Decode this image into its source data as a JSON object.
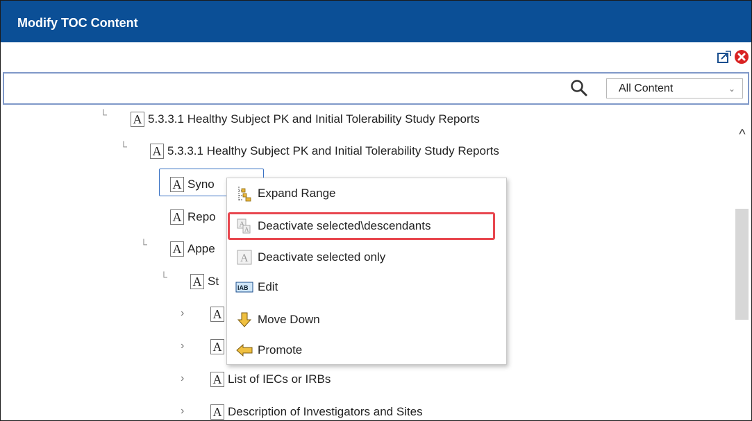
{
  "window": {
    "title": "Modify TOC Content"
  },
  "toolbar": {
    "icons": [
      "export-icon",
      "close-icon"
    ],
    "accent": "#0b4f96",
    "close_color": "#d92323"
  },
  "search": {
    "value": "",
    "placeholder": ""
  },
  "filter": {
    "selected": "All Content"
  },
  "tree": {
    "nodes": [
      {
        "label": "5.3.3.1 Healthy Subject PK and Initial Tolerability Study Reports",
        "marker": "A"
      },
      {
        "label": "5.3.3.1 Healthy Subject PK and Initial Tolerability Study Reports",
        "marker": "A"
      },
      {
        "label": "Syno",
        "marker": "A"
      },
      {
        "label": "Repo",
        "marker": "A"
      },
      {
        "label": "Appe",
        "marker": "A"
      },
      {
        "label": "St",
        "marker": "A"
      },
      {
        "label": "A",
        "marker": "A"
      },
      {
        "label": "A",
        "marker": "A"
      },
      {
        "label": "List of IECs or IRBs",
        "marker": "A"
      },
      {
        "label": "Description of Investigators and Sites",
        "marker": "A"
      }
    ]
  },
  "context_menu": {
    "items": [
      {
        "label": "Expand Range",
        "icon": "expand-range-icon"
      },
      {
        "label": "Deactivate selected\\descendants",
        "icon": "deactivate-descendants-icon"
      },
      {
        "label": "Deactivate selected only",
        "icon": "deactivate-icon"
      },
      {
        "label": "Edit",
        "icon": "edit-icon"
      },
      {
        "label": "Move Down",
        "icon": "move-down-icon"
      },
      {
        "label": "Promote",
        "icon": "promote-icon"
      }
    ],
    "highlight_color": "#e8474f"
  }
}
